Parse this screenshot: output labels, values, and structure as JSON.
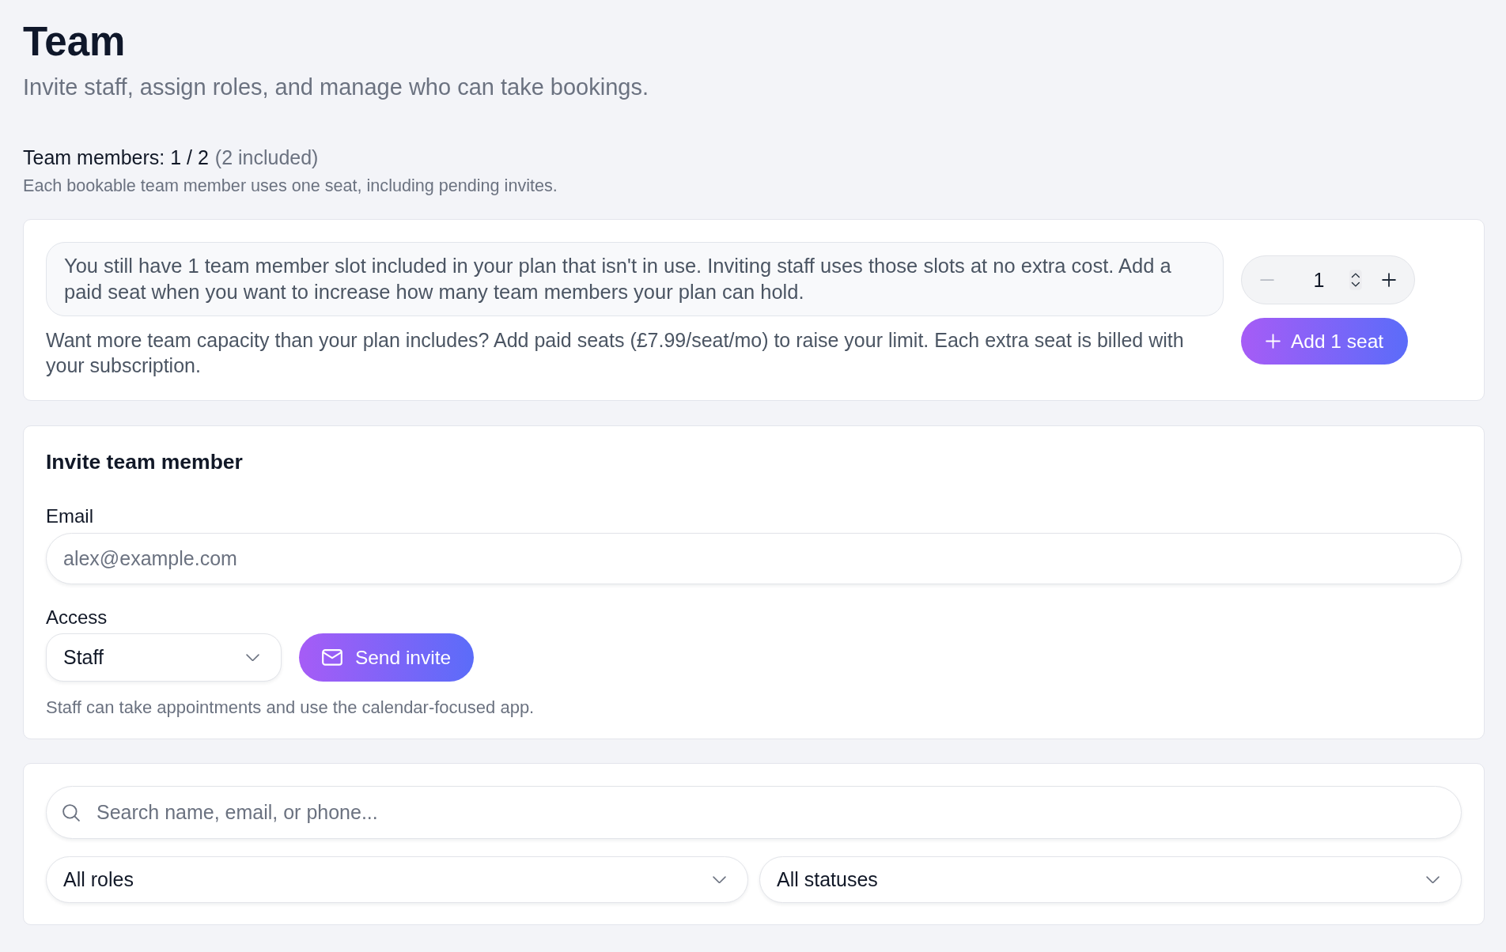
{
  "header": {
    "title": "Team",
    "subtitle": "Invite staff, assign roles, and manage who can take bookings."
  },
  "seat_usage": {
    "count": "Team members: 1 / 2",
    "included": "(2 included)",
    "note": "Each bookable team member uses one seat, including pending invites."
  },
  "seat_card": {
    "notice": "You still have 1 team member slot included in your plan that isn't in use. Inviting staff uses those slots at no extra cost. Add a paid seat when you want to increase how many team members your plan can hold.",
    "description": "Want more team capacity than your plan includes? Add paid seats (£7.99/seat/mo) to raise your limit. Each extra seat is billed with your subscription.",
    "stepper": {
      "value": "1",
      "decrease_disabled": true,
      "increase_disabled": false
    },
    "add_button": "Add 1 seat"
  },
  "invite": {
    "title": "Invite team member",
    "email": {
      "label": "Email",
      "placeholder": "alex@example.com"
    },
    "access": {
      "label": "Access",
      "value": "Staff"
    },
    "send_button": "Send invite",
    "hint": "Staff can take appointments and use the calendar-focused app."
  },
  "filters": {
    "search": {
      "placeholder": "Search name, email, or phone..."
    },
    "selects": [
      {
        "value": "All roles"
      },
      {
        "value": "All statuses"
      }
    ]
  }
}
